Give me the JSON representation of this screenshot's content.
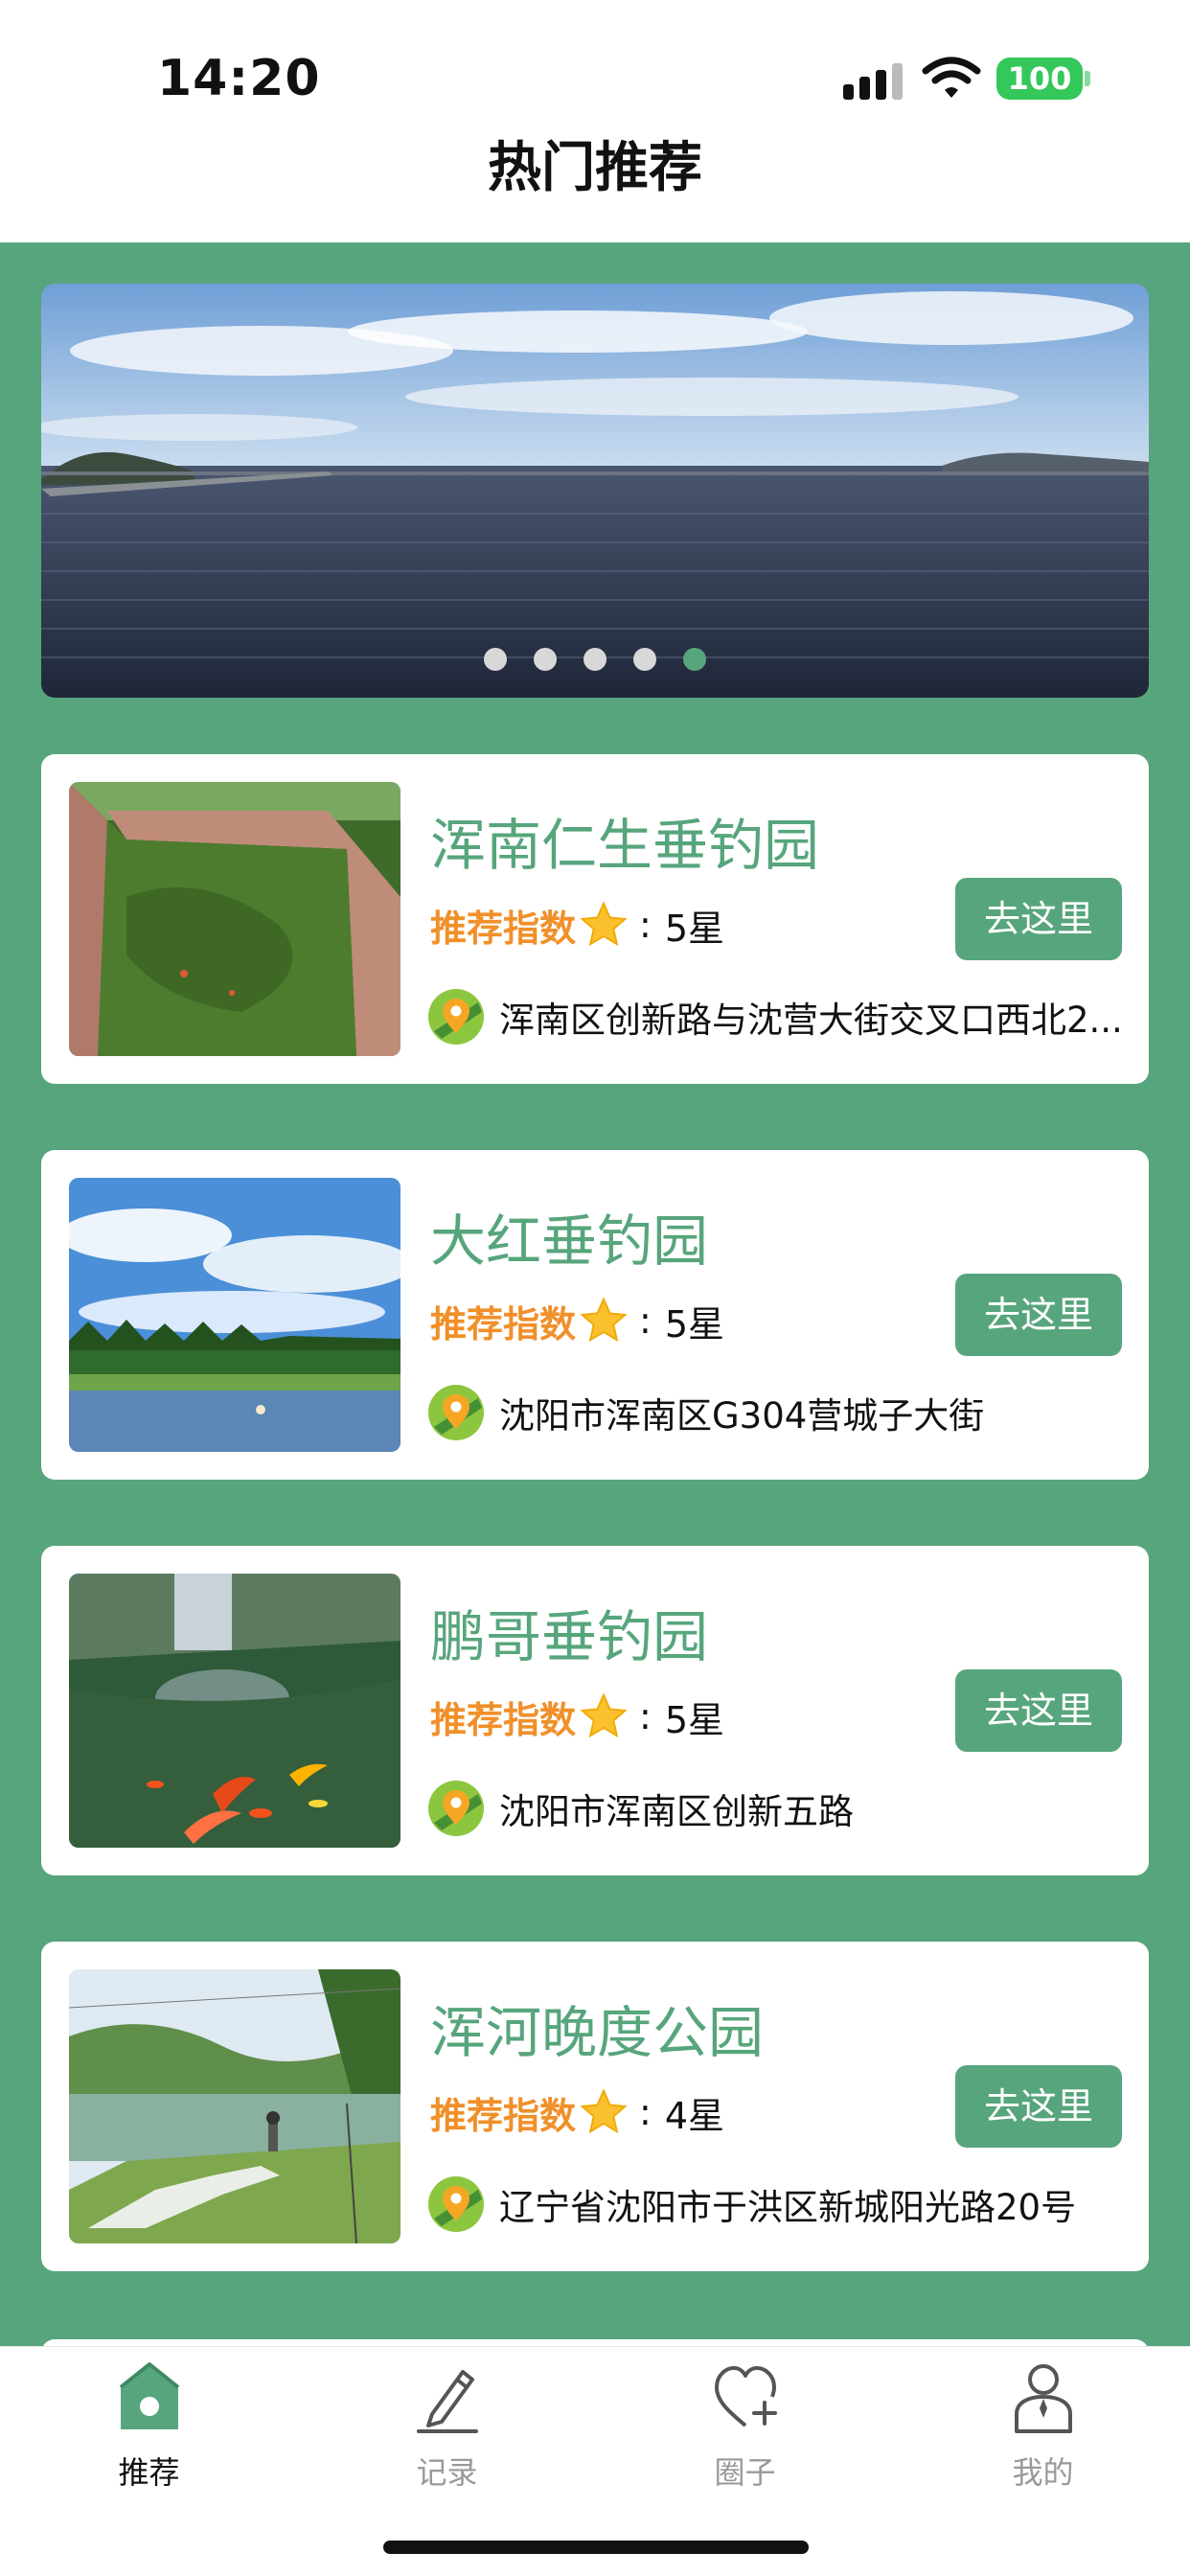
{
  "status_bar": {
    "time": "14:20",
    "battery": "100"
  },
  "header": {
    "title": "热门推荐"
  },
  "banner": {
    "dot_count": 5,
    "active_dot": 5
  },
  "rating_label": "推荐指数",
  "go_label": "去这里",
  "spots": [
    {
      "name": "浑南仁生垂钓园",
      "rating": "5星",
      "address": "浑南区创新路与沈营大街交叉口西北2..."
    },
    {
      "name": "大红垂钓园",
      "rating": "5星",
      "address": "沈阳市浑南区G304营城子大街"
    },
    {
      "name": "鹏哥垂钓园",
      "rating": "5星",
      "address": "沈阳市浑南区创新五路"
    },
    {
      "name": "浑河晚度公园",
      "rating": "4星",
      "address": "辽宁省沈阳市于洪区新城阳光路20号"
    }
  ],
  "tabs": [
    {
      "label": "推荐",
      "icon": "home-icon",
      "active": true
    },
    {
      "label": "记录",
      "icon": "pencil-icon",
      "active": false
    },
    {
      "label": "圈子",
      "icon": "heart-plus-icon",
      "active": false
    },
    {
      "label": "我的",
      "icon": "user-icon",
      "active": false
    }
  ],
  "colors": {
    "primary": "#57a57c",
    "accent": "#f0902a",
    "tab_inactive": "#999999"
  }
}
